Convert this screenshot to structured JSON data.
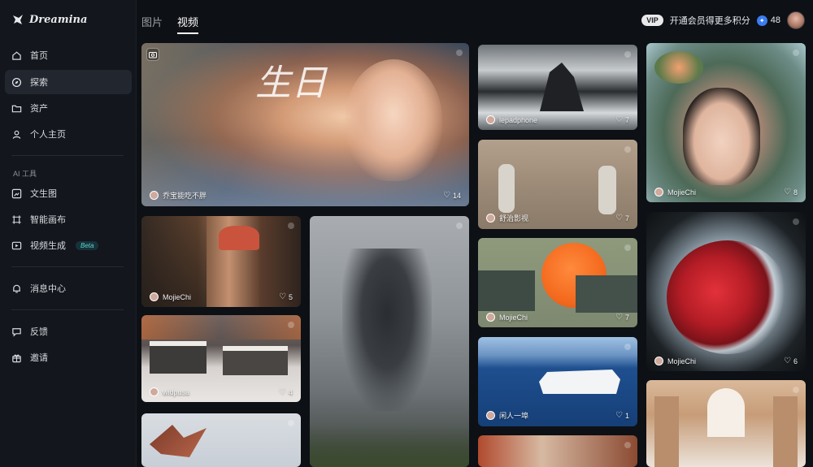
{
  "app": {
    "name": "Dreamina"
  },
  "sidebar": {
    "items": [
      {
        "label": "首页"
      },
      {
        "label": "探索"
      },
      {
        "label": "资产"
      },
      {
        "label": "个人主页"
      }
    ],
    "ai_section_label": "AI 工具",
    "ai_items": [
      {
        "label": "文生图"
      },
      {
        "label": "智能画布"
      },
      {
        "label": "视频生成",
        "badge": "Beta"
      }
    ],
    "message_center": "消息中心",
    "feedback": "反馈",
    "invite": "邀请"
  },
  "tabs": [
    {
      "label": "图片"
    },
    {
      "label": "视频"
    }
  ],
  "topbar": {
    "vip_badge": "VIP",
    "vip_promo": "开通会员得更多积分",
    "credits": "48"
  },
  "cards": [
    {
      "author": "乔宝能吃不胖",
      "likes": "14",
      "title_text": "生日"
    },
    {
      "author": "MojieChi",
      "likes": "5"
    },
    {
      "author": "widpusa",
      "likes": "4"
    },
    {
      "author": "lepadphone",
      "likes": "7"
    },
    {
      "author": "舒治影视",
      "likes": "7"
    },
    {
      "author": "MojieChi",
      "likes": "7"
    },
    {
      "author": "闲人一埠",
      "likes": "1"
    },
    {
      "author": "MojieChi",
      "likes": "8"
    },
    {
      "author": "MojieChi",
      "likes": "6"
    }
  ],
  "colors": {
    "background": "#0d1015",
    "sidebar": "#13161c",
    "accent_beta": "#5fd3c8",
    "coin": "#3b7df0"
  }
}
